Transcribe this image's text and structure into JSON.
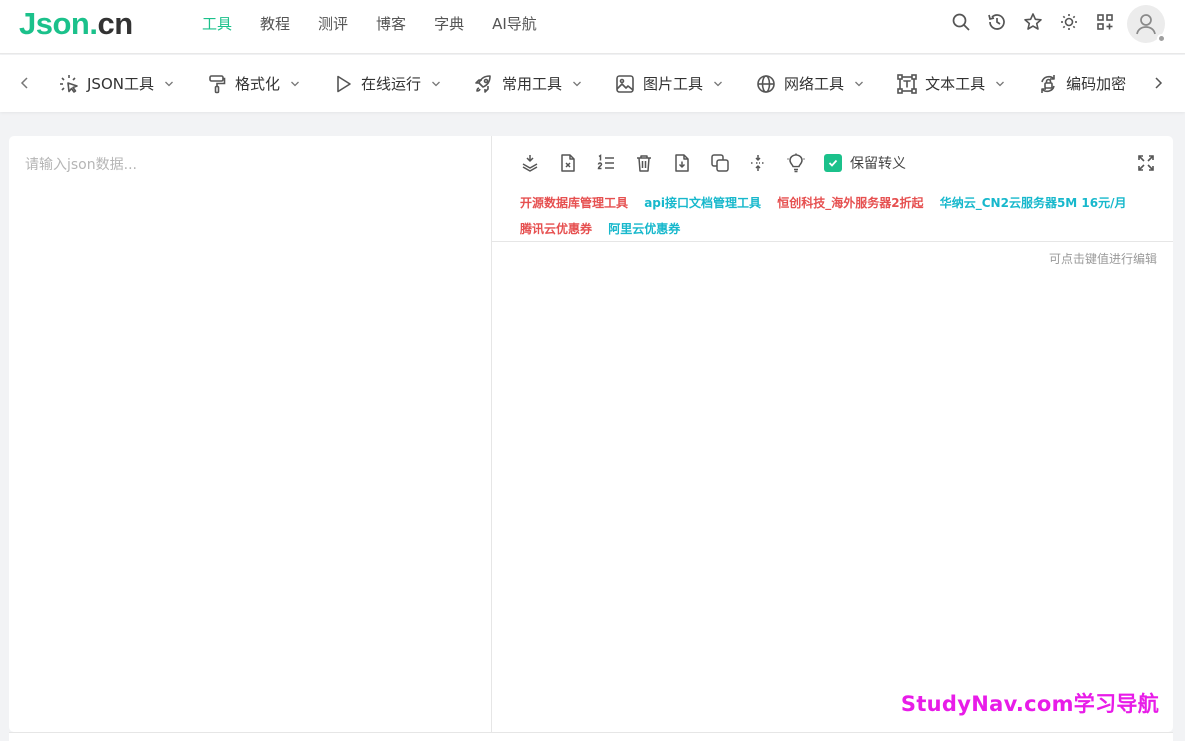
{
  "logo": {
    "part1": "Json.",
    "part2": "cn"
  },
  "topnav": [
    {
      "label": "工具",
      "active": true
    },
    {
      "label": "教程",
      "active": false
    },
    {
      "label": "测评",
      "active": false
    },
    {
      "label": "博客",
      "active": false
    },
    {
      "label": "字典",
      "active": false
    },
    {
      "label": "AI导航",
      "active": false
    }
  ],
  "header_icons": [
    "search-icon",
    "history-icon",
    "star-icon",
    "theme-sun-icon",
    "apps-icon"
  ],
  "toolnav": [
    {
      "label": "JSON工具",
      "icon": "cursor-click-icon"
    },
    {
      "label": "格式化",
      "icon": "paint-roller-icon"
    },
    {
      "label": "在线运行",
      "icon": "play-icon"
    },
    {
      "label": "常用工具",
      "icon": "rocket-icon"
    },
    {
      "label": "图片工具",
      "icon": "image-icon"
    },
    {
      "label": "网络工具",
      "icon": "globe-icon"
    },
    {
      "label": "文本工具",
      "icon": "text-frame-icon"
    },
    {
      "label": "编码加密",
      "icon": "encode-icon"
    }
  ],
  "editor": {
    "input_placeholder": "请输入json数据...",
    "keep_escape_label": "保留转义",
    "keep_escape_checked": true,
    "edit_hint": "可点击键值进行编辑",
    "ads": [
      {
        "text": "开源数据库管理工具",
        "color": "#e65050"
      },
      {
        "text": "api接口文档管理工具",
        "color": "#17b8cc"
      },
      {
        "text": "恒创科技_海外服务器2折起",
        "color": "#e65050"
      },
      {
        "text": "华纳云_CN2云服务器5M 16元/月",
        "color": "#17b8cc"
      },
      {
        "text": "腾讯云优惠券",
        "color": "#e65050"
      },
      {
        "text": "阿里云优惠券",
        "color": "#17b8cc"
      }
    ]
  },
  "watermark": "StudyNav.com学习导航",
  "colors": {
    "accent": "#1bc18b",
    "ad_red": "#e65050",
    "ad_cyan": "#17b8cc",
    "watermark": "#e81ce8"
  }
}
